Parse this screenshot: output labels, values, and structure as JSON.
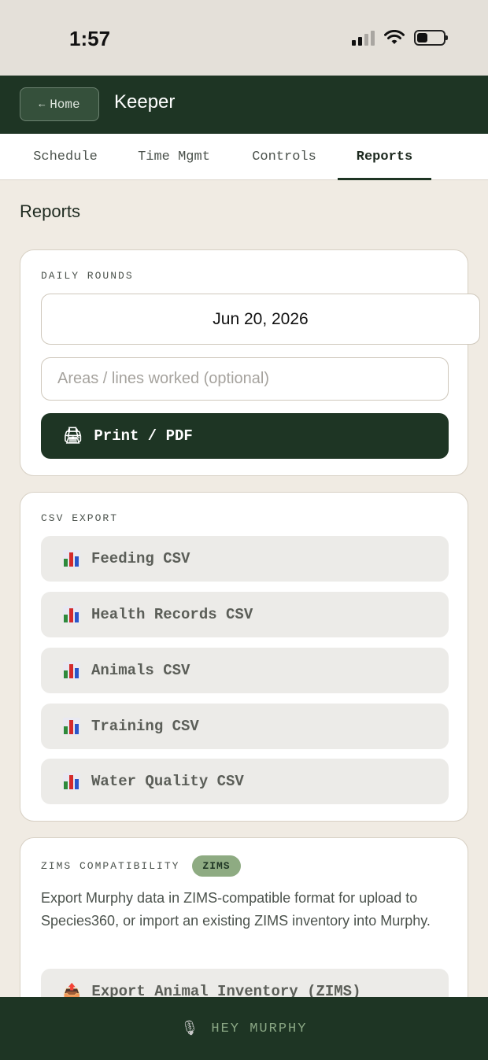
{
  "status_bar": {
    "time": "1:57"
  },
  "header": {
    "back_label": "Home",
    "back_arrow": "←",
    "title": "Keeper"
  },
  "tabs": [
    {
      "label": "Schedule",
      "active": false
    },
    {
      "label": "Time Mgmt",
      "active": false
    },
    {
      "label": "Controls",
      "active": false
    },
    {
      "label": "Reports",
      "active": true
    }
  ],
  "page_title": "Reports",
  "daily_rounds": {
    "label": "DAILY ROUNDS",
    "date": "Jun 20, 2026",
    "areas_placeholder": "Areas / lines worked (optional)",
    "print_label": "Print / PDF",
    "print_icon": "printer-icon"
  },
  "csv_export": {
    "label": "CSV EXPORT",
    "icon": "bar-chart-icon",
    "buttons": [
      "Feeding CSV",
      "Health Records CSV",
      "Animals CSV",
      "Training CSV",
      "Water Quality CSV"
    ]
  },
  "zims": {
    "label": "ZIMS COMPATIBILITY",
    "badge": "ZIMS",
    "description": "Export Murphy data in ZIMS-compatible format for upload to Species360, or import an existing ZIMS inventory into Murphy.",
    "export_label": "Export Animal Inventory (ZIMS)",
    "export_icon": "outbox-tray-icon"
  },
  "bottom_bar": {
    "label": "HEY MURPHY",
    "icon": "microphone-icon"
  },
  "colors": {
    "brand_dark_green": "#1e3524",
    "background": "#f0ebe3",
    "badge_green": "#8eab82"
  }
}
